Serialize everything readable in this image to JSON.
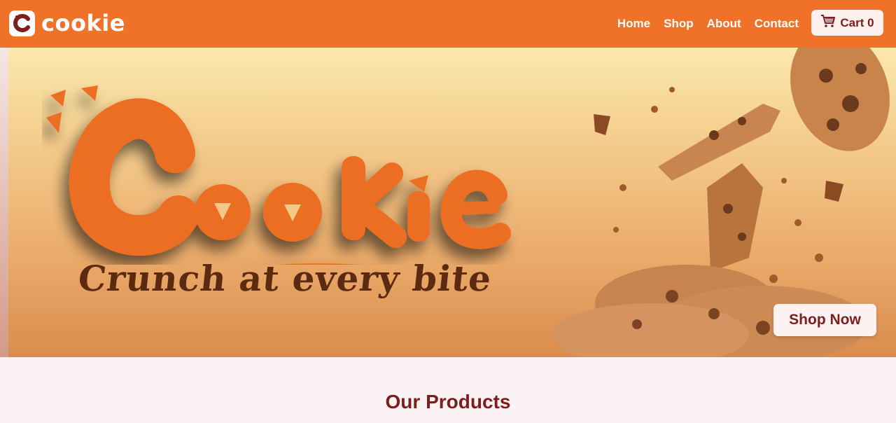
{
  "header": {
    "logo_text": "cookie",
    "nav": [
      "Home",
      "Shop",
      "About",
      "Contact"
    ],
    "cart_label": "Cart 0"
  },
  "hero": {
    "wordmark": "CooKiE",
    "tagline": "Crunch at every bite",
    "cta": "Shop Now"
  },
  "products": {
    "title": "Our Products"
  },
  "colors": {
    "brand_orange": "#f07228",
    "dark_red": "#7a1e1e",
    "page_bg": "#fbf2f3"
  },
  "icons": [
    "cookie-logo-icon",
    "cart-icon"
  ]
}
